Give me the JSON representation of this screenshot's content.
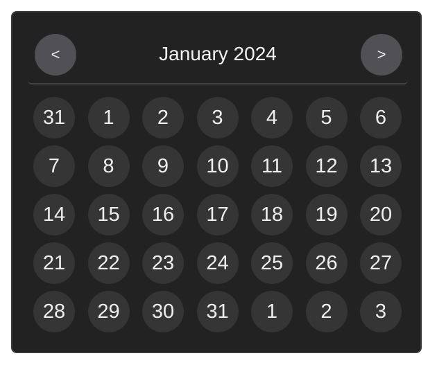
{
  "header": {
    "prev_label": "<",
    "next_label": ">",
    "month_title": "January 2024"
  },
  "days": [
    "31",
    "1",
    "2",
    "3",
    "4",
    "5",
    "6",
    "7",
    "8",
    "9",
    "10",
    "11",
    "12",
    "13",
    "14",
    "15",
    "16",
    "17",
    "18",
    "19",
    "20",
    "21",
    "22",
    "23",
    "24",
    "25",
    "26",
    "27",
    "28",
    "29",
    "30",
    "31",
    "1",
    "2",
    "3"
  ],
  "colors": {
    "panel_background": "#222222",
    "nav_button": "#505055",
    "day_cell": "#353535",
    "text": "#f2f2f2"
  }
}
